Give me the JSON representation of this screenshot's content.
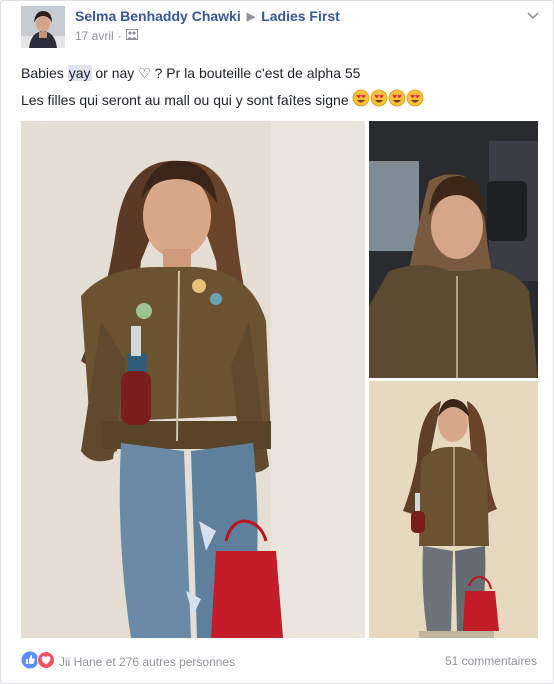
{
  "post": {
    "author": "Selma Benhaddy Chawki",
    "group": "Ladies First",
    "date": "17 avril",
    "text_line1_a": "Babies ",
    "text_line1_highlight": "yay",
    "text_line1_b": " or nay ♡ ? Pr la bouteille c'est de alpha 55",
    "text_line2": "Les filles qui seront au mall ou qui y sont faîtes signe"
  },
  "footer": {
    "reactions_text": "Jii Hane et 276 autres personnes",
    "comments_text": "51 commentaires"
  },
  "icons": {
    "like": "like-icon",
    "love": "love-icon",
    "privacy": "group-privacy-icon",
    "options": "chevron-down-icon"
  },
  "colors": {
    "link": "#365899",
    "meta": "#90949c",
    "text": "#1d2129",
    "like_blue": "#5890ff",
    "love_red": "#f25268"
  }
}
